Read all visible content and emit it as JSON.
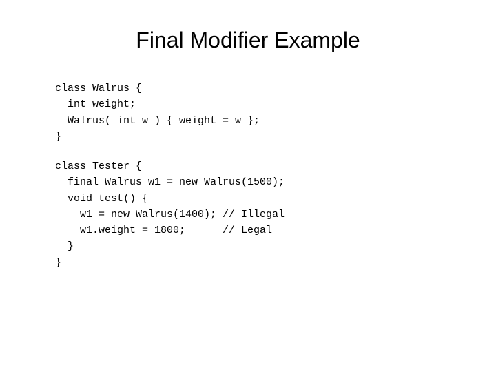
{
  "title": "Final Modifier Example",
  "code": {
    "section1": [
      "class Walrus {",
      "  int weight;",
      "  Walrus( int w ) { weight = w };",
      "}"
    ],
    "section2": [
      "class Tester {",
      "  final Walrus w1 = new Walrus(1500);",
      "  void test() {",
      "    w1 = new Walrus(1400); // Illegal",
      "    w1.weight = 1800;      // Legal",
      "  }",
      "}"
    ]
  }
}
